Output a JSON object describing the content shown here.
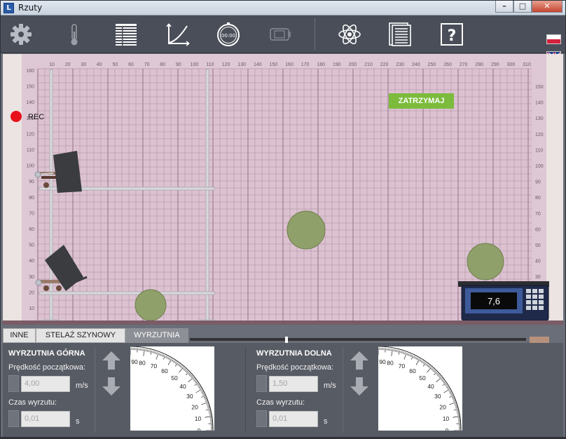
{
  "window": {
    "title": "Rzuty",
    "app_icon_letter": "L",
    "controls": {
      "minimize": "–",
      "maximize": "□",
      "close": "✕"
    }
  },
  "toolbar": {
    "icons": [
      "gear-icon",
      "thermometer-icon",
      "table-icon",
      "graph-icon",
      "stopwatch-icon",
      "camera-icon",
      "atom-icon",
      "document-icon",
      "help-icon"
    ],
    "stopwatch_text": "00:00",
    "help_text": "?",
    "languages": [
      "pl-flag-icon",
      "en-flag-icon"
    ]
  },
  "simulation": {
    "rec_label": "REC",
    "stop_button_label": "ZATRZYMAJ",
    "scale_reading": "7,6",
    "colors": {
      "grid_bg": "#ddc4d3",
      "stop_button": "#7cbb3c",
      "ball": "#8fa06a",
      "rec": "#e8101a"
    },
    "ruler": {
      "top_ticks": [
        "10",
        "20",
        "30",
        "40",
        "50",
        "60",
        "70",
        "80",
        "90",
        "100",
        "110",
        "120",
        "130",
        "140",
        "150",
        "160",
        "170",
        "180",
        "190",
        "200",
        "210",
        "220",
        "230",
        "240",
        "250",
        "260",
        "270",
        "280",
        "290",
        "300",
        "310"
      ],
      "left_ticks": [
        "160",
        "150",
        "140",
        "130",
        "120",
        "110",
        "100",
        "90",
        "80",
        "70",
        "60",
        "50",
        "40",
        "30",
        "20",
        "10"
      ],
      "right_ticks": [
        "150",
        "140",
        "130",
        "120",
        "110",
        "100",
        "90",
        "80",
        "70",
        "60",
        "50",
        "40",
        "30",
        "20",
        "10"
      ]
    }
  },
  "tabs": [
    {
      "label": "INNE",
      "active": false
    },
    {
      "label": "STELAŻ SZYNOWY",
      "active": false
    },
    {
      "label": "WYRZUTNIA",
      "active": true
    }
  ],
  "launchers": {
    "upper": {
      "title": "WYRZUTNIA GÓRNA",
      "speed_label": "Prędkość początkowa:",
      "speed_value": "4,00",
      "speed_unit": "m/s",
      "time_label": "Czas wyrzutu:",
      "time_value": "0,01",
      "time_unit": "s"
    },
    "lower": {
      "title": "WYRZUTNIA DOLNA",
      "speed_label": "Prędkość początkowa:",
      "speed_value": "1,50",
      "speed_unit": "m/s",
      "time_label": "Czas wyrzutu:",
      "time_value": "0,01",
      "time_unit": "s"
    },
    "protractor_labels": [
      "90",
      "80",
      "70",
      "60",
      "50",
      "40",
      "30",
      "20",
      "10",
      "0"
    ]
  }
}
